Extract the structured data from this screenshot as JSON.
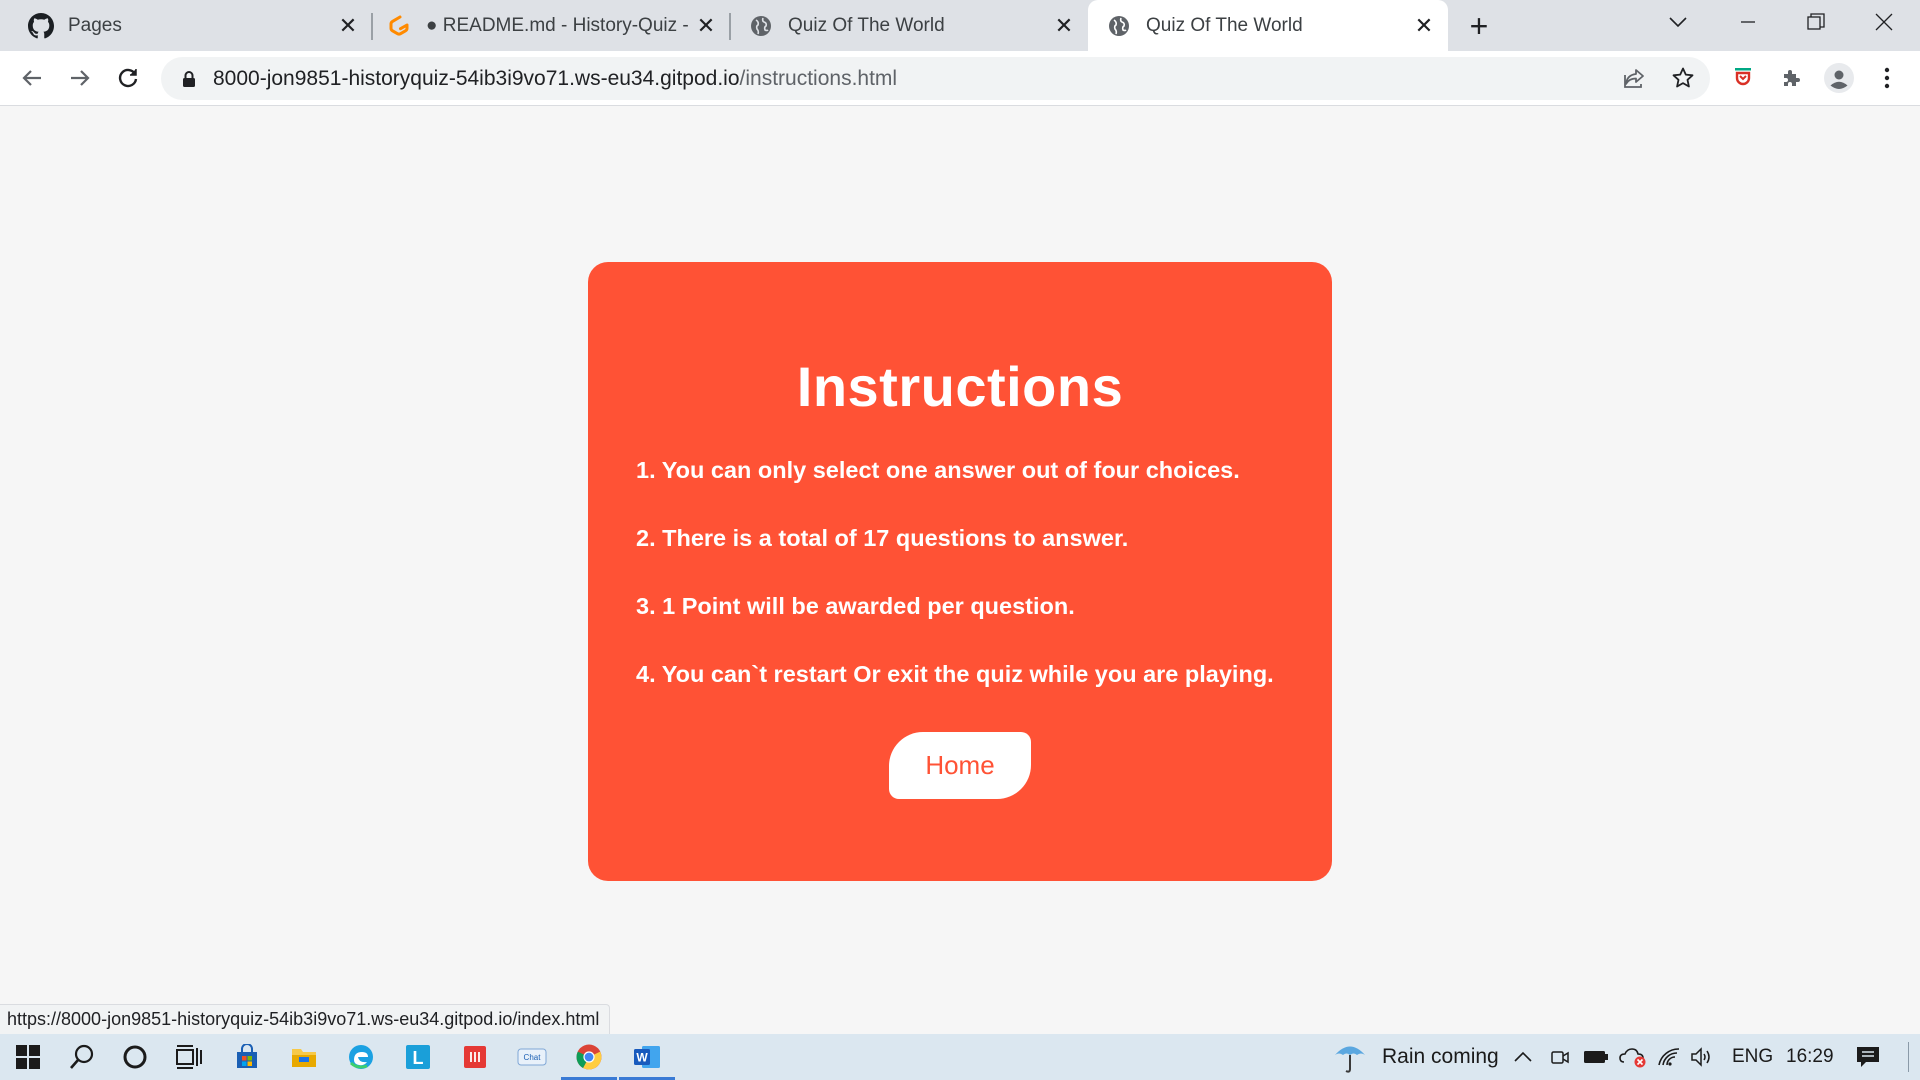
{
  "browser": {
    "tabs": [
      {
        "title": "Pages",
        "icon": "github-icon"
      },
      {
        "title": "● README.md - History-Quiz - G",
        "icon": "gitpod-icon"
      },
      {
        "title": "Quiz Of The World",
        "icon": "globe-icon"
      },
      {
        "title": "Quiz Of The World",
        "icon": "globe-icon",
        "active": true
      }
    ],
    "address": {
      "host": "8000-jon9851-historyquiz-54ib3i9vo71.ws-eu34.gitpod.io",
      "path": "/instructions.html"
    },
    "status_url": "https://8000-jon9851-historyquiz-54ib3i9vo71.ws-eu34.gitpod.io/index.html"
  },
  "page": {
    "heading": "Instructions",
    "rules": [
      "1. You can only select one answer out of four choices.",
      "2. There is a total of 17 questions to answer.",
      "3. 1 Point will be awarded per question.",
      "4. You can`t restart Or exit the quiz while you are playing."
    ],
    "home_button": "Home"
  },
  "taskbar": {
    "weather": "Rain coming",
    "language": "ENG",
    "time": "16:29"
  },
  "colors": {
    "card": "#ff5235",
    "page_background": "#f6f6f6",
    "card_text": "#ffffff"
  }
}
